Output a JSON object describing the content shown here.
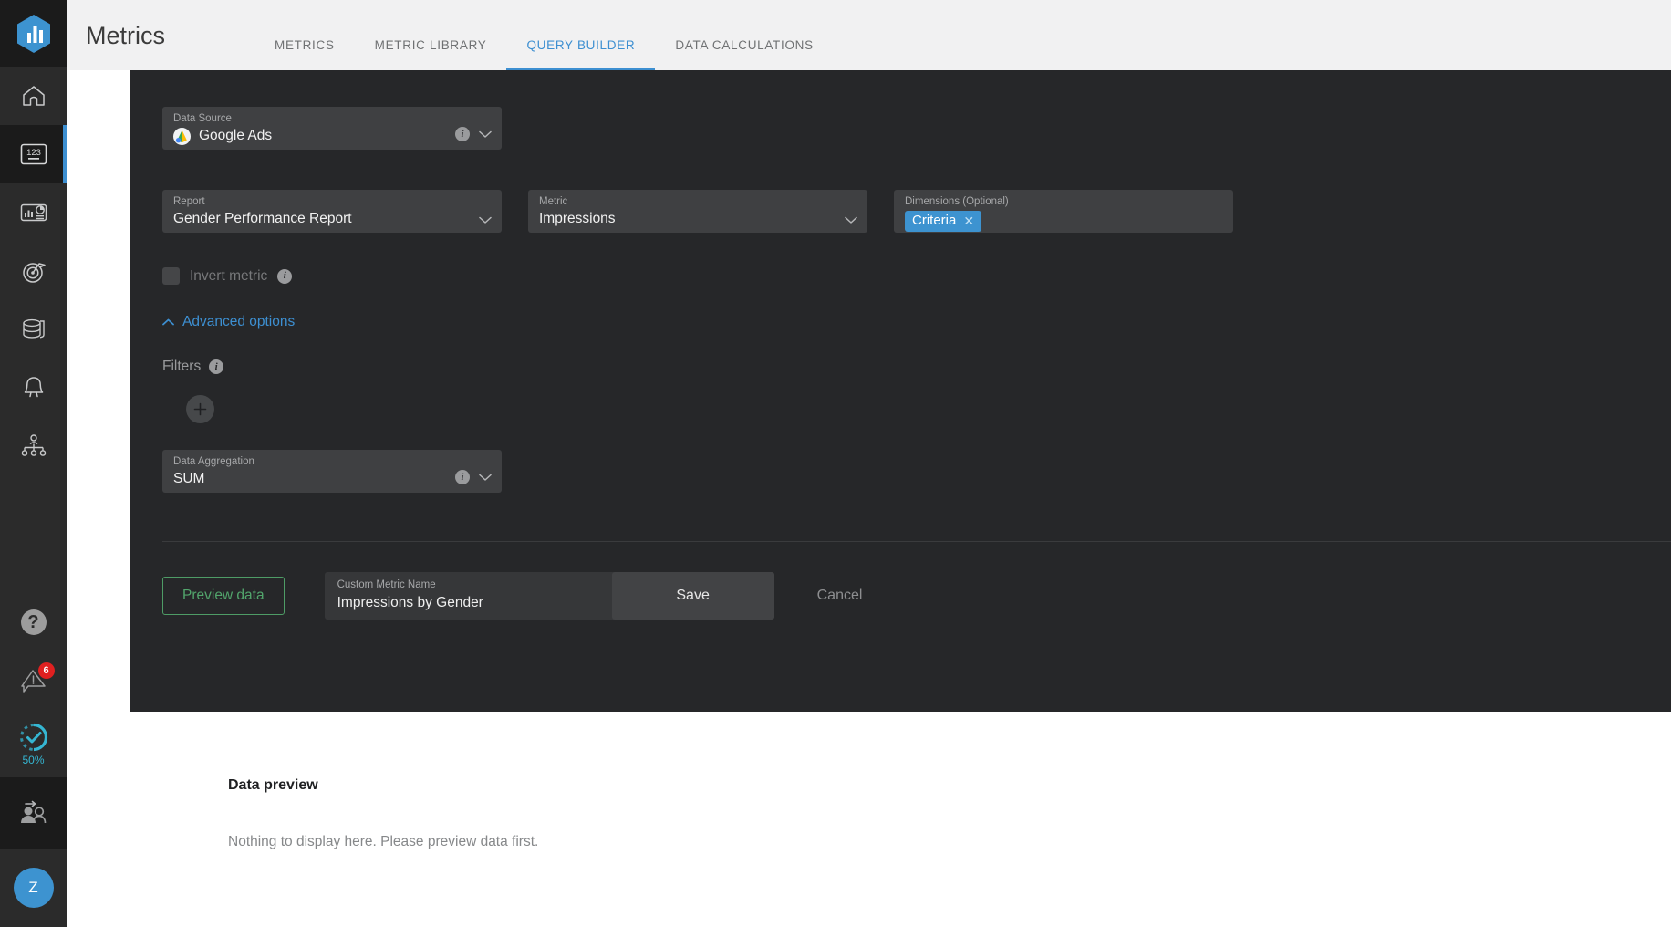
{
  "header": {
    "title": "Metrics",
    "tabs": [
      {
        "label": "METRICS",
        "active": false
      },
      {
        "label": "METRIC LIBRARY",
        "active": false
      },
      {
        "label": "QUERY BUILDER",
        "active": true
      },
      {
        "label": "DATA CALCULATIONS",
        "active": false
      }
    ],
    "accent_color": "#3d8fd1"
  },
  "sidebar": {
    "logo": "logo-hexagon-bar-chart",
    "items": [
      {
        "name": "home",
        "icon": "home-icon",
        "active": false
      },
      {
        "name": "metrics",
        "icon": "numbers-123-icon",
        "active": true
      },
      {
        "name": "reports",
        "icon": "report-chart-icon",
        "active": false
      },
      {
        "name": "goals",
        "icon": "target-flag-icon",
        "active": false
      },
      {
        "name": "data-sources",
        "icon": "database-stack-icon",
        "active": false
      },
      {
        "name": "alerts",
        "icon": "bell-icon",
        "active": false
      },
      {
        "name": "organization",
        "icon": "org-chart-icon",
        "active": false
      }
    ],
    "bottom": {
      "help": {
        "icon": "question-mark-icon",
        "label": "?"
      },
      "notifications": {
        "icon": "alert-triangle-icon",
        "badge": "6",
        "badge_color": "#e02020"
      },
      "onboarding": {
        "icon": "progress-check-icon",
        "label": "50%",
        "color": "#35b6d2"
      },
      "invite": {
        "icon": "invite-user-icon"
      },
      "avatar": {
        "initial": "Z",
        "color": "#3d93d0"
      }
    }
  },
  "builder": {
    "data_source": {
      "label": "Data Source",
      "value": "Google Ads",
      "icon": "google-ads-icon",
      "info_icon": "info-icon",
      "chevron": "chevron-down-icon"
    },
    "report": {
      "label": "Report",
      "value": "Gender Performance Report",
      "chevron": "chevron-down-icon"
    },
    "metric": {
      "label": "Metric",
      "value": "Impressions",
      "chevron": "chevron-down-icon"
    },
    "dimensions": {
      "label": "Dimensions (Optional)",
      "chips": [
        {
          "label": "Criteria",
          "remove_icon": "close-icon"
        }
      ],
      "chip_color": "#3d93d0"
    },
    "invert_metric": {
      "label": "Invert metric",
      "checked": false,
      "disabled": true,
      "info_icon": "info-icon"
    },
    "advanced_options": {
      "label": "Advanced options",
      "expanded": true,
      "caret": "caret-up-icon"
    },
    "filters": {
      "label": "Filters",
      "info_icon": "info-icon",
      "add_icon": "plus-icon"
    },
    "data_aggregation": {
      "label": "Data Aggregation",
      "value": "SUM",
      "info_icon": "info-icon",
      "chevron": "chevron-down-icon"
    },
    "actions": {
      "preview_label": "Preview data",
      "preview_color": "#52a56c",
      "metric_name_label": "Custom Metric Name",
      "metric_name_value": "Impressions by Gender",
      "save_label": "Save",
      "cancel_label": "Cancel"
    }
  },
  "preview": {
    "title": "Data preview",
    "empty_message": "Nothing to display here. Please preview data first."
  }
}
